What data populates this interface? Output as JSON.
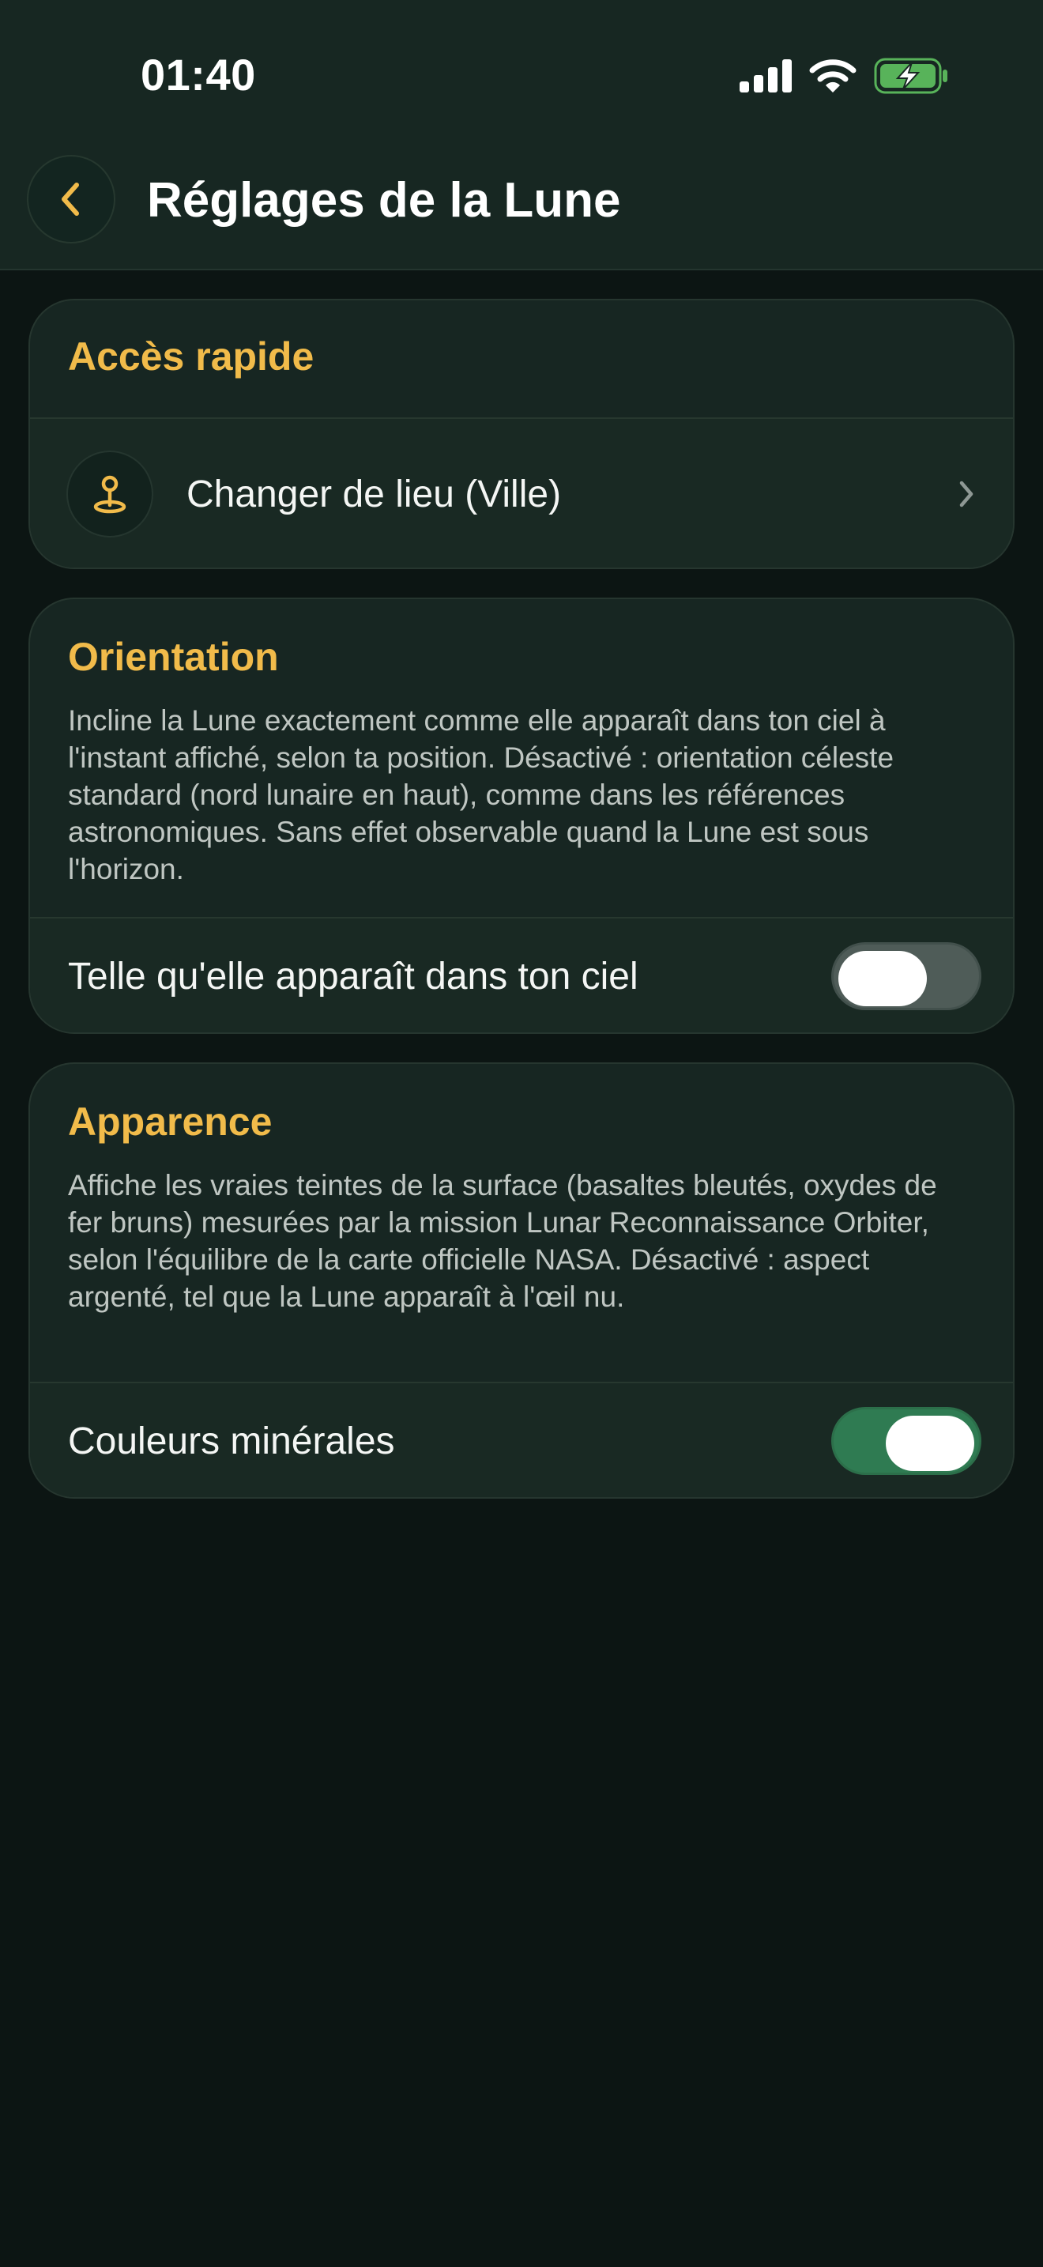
{
  "status_bar": {
    "time": "01:40"
  },
  "header": {
    "title": "Réglages de la Lune"
  },
  "quick_access": {
    "heading": "Accès rapide",
    "change_location_label": "Changer de lieu (Ville)"
  },
  "orientation": {
    "heading": "Orientation",
    "description": "Incline la Lune exactement comme elle apparaît dans ton ciel à l'instant affiché, selon ta position. Désactivé : orientation céleste standard (nord lunaire en haut), comme dans les références astronomiques. Sans effet observable quand la Lune est sous l'horizon.",
    "toggle_label": "Telle qu'elle apparaît dans ton ciel",
    "toggle_on": false
  },
  "appearance": {
    "heading": "Apparence",
    "description": "Affiche les vraies teintes de la surface (basaltes bleutés, oxydes de fer bruns) mesurées par la mission Lunar Reconnaissance Orbiter, selon l'équilibre de la carte officielle NASA. Désactivé : aspect argenté, tel que la Lune apparaît à l'œil nu.",
    "toggle_label": "Couleurs minérales",
    "toggle_on": true
  },
  "colors": {
    "accent": "#f1bb4a",
    "toggle_on": "#2f7b52",
    "toggle_off": "#4f5c58",
    "background": "#0c1513"
  },
  "icons": {
    "back": "chevron-left-icon",
    "location": "location-pin-icon",
    "row_chevron": "chevron-right-icon"
  }
}
